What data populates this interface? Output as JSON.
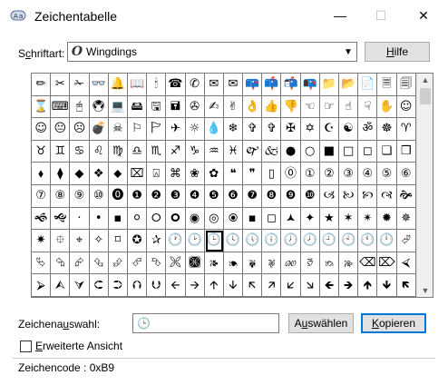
{
  "window": {
    "title": "Zeichentabelle",
    "minimize_icon": "minimize-icon",
    "maximize_icon": "maximize-icon",
    "close_icon": "close-icon"
  },
  "font": {
    "label_pre": "S",
    "label_ul": "c",
    "label_post": "hriftart:",
    "symbol": "O",
    "value": "Wingdings"
  },
  "help_button": {
    "label_ul": "H",
    "label_post": "ilfe"
  },
  "grid": {
    "rows": [
      [
        "✏",
        "✂",
        "✁",
        "👓",
        "🔔",
        "📖",
        "🕯",
        "☎",
        "✆",
        "✉",
        "✉",
        "📪",
        "📫",
        "📬",
        "📭",
        "📁",
        "📂",
        "📄",
        "🗏",
        "🗐"
      ],
      [
        "⌛",
        "⌨",
        "🖰",
        "🖲",
        "💻",
        "🖴",
        "🖫",
        "🖬",
        "✇",
        "✍",
        "✌",
        "👌",
        "👍",
        "👎",
        "☜",
        "☞",
        "☝",
        "☟",
        "✋",
        "☺"
      ],
      [
        "☺",
        "😐",
        "☹",
        "💣",
        "☠",
        "⚐",
        "🏱",
        "✈",
        "☼",
        "💧",
        "❄",
        "✞",
        "✞",
        "✠",
        "✡",
        "☪",
        "☯",
        "ॐ",
        "☸",
        "♈"
      ],
      [
        "♉",
        "♊",
        "♋",
        "♌",
        "♍",
        "♎",
        "♏",
        "♐",
        "♑",
        "♒",
        "♓",
        "🙰",
        "🙵",
        "●",
        "○",
        "■",
        "□",
        "◻",
        "❑",
        "❒"
      ],
      [
        "⬧",
        "⧫",
        "◆",
        "❖",
        "⬥",
        "⌧",
        "⍓",
        "⌘",
        "❀",
        "✿",
        "❝",
        "❞",
        "▯",
        "⓪",
        "①",
        "②",
        "③",
        "④",
        "⑤",
        "⑥"
      ],
      [
        "⑦",
        "⑧",
        "⑨",
        "⑩",
        "⓿",
        "❶",
        "❷",
        "❸",
        "❹",
        "❺",
        "❻",
        "❼",
        "❽",
        "❾",
        "❿",
        "🙢",
        "🙠",
        "🙡",
        "🙣",
        "🙞"
      ],
      [
        "🙜",
        "🙝",
        "·",
        "•",
        "▪",
        "⚪",
        "🞆",
        "🞈",
        "◉",
        "◎",
        "🞊",
        "▪",
        "◻",
        "🟂",
        "✦",
        "★",
        "✶",
        "✴",
        "✹",
        "✵"
      ],
      [
        "✷",
        "⯐",
        "⌖",
        "✧",
        "⌑",
        "✪",
        "✰",
        "🕐",
        "🕑",
        "🕒",
        "🕓",
        "🕔",
        "🕕",
        "🕖",
        "🕗",
        "🕘",
        "🕙",
        "🕚",
        "🕛",
        "⮰"
      ],
      [
        "⮱",
        "⮲",
        "⮳",
        "⮴",
        "⮵",
        "⮶",
        "⮷",
        "🙪",
        "🙫",
        "🙕",
        "🙔",
        "🙗",
        "🙖",
        "🙐",
        "🙑",
        "🙒",
        "🙓",
        "⌫",
        "⌦",
        "⮘"
      ],
      [
        "⮚",
        "⮙",
        "⮛",
        "⮈",
        "⮊",
        "⮉",
        "⮋",
        "🡨",
        "🡪",
        "🡩",
        "🡫",
        "🡬",
        "🡭",
        "🡯",
        "🡮",
        "🡸",
        "🡺",
        "🡹",
        "🡻",
        "🡼"
      ]
    ]
  },
  "selection": {
    "label_pre": "Zeichena",
    "label_ul": "u",
    "label_post": "swahl:",
    "value": "🕒"
  },
  "choose_button": {
    "label_pre": "A",
    "label_ul": "u",
    "label_post": "swählen"
  },
  "copy_button": {
    "label_ul": "K",
    "label_post": "opieren"
  },
  "advanced": {
    "label_ul": "E",
    "label_post": "rweiterte Ansicht"
  },
  "status": {
    "text": "Zeichencode : 0xB9"
  }
}
